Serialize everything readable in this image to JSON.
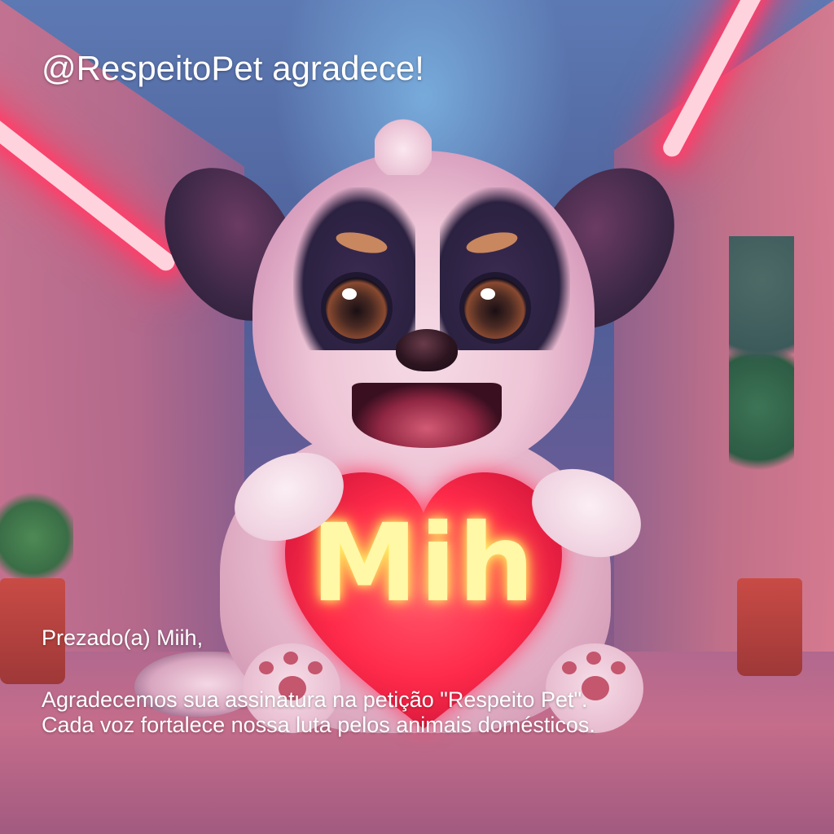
{
  "image": {
    "description_text_overlay": true
  },
  "header": {
    "title": "@RespeitoPet agradece!"
  },
  "heart": {
    "name": "Mih"
  },
  "message": {
    "greeting": "Prezado(a) Miih,",
    "line1": "Agradecemos sua assinatura na petição \"Respeito Pet\".",
    "line2": "Cada voz fortalece nossa luta pelos animais domésticos."
  },
  "colors": {
    "neon": "#ff3f6a",
    "heart": "#ff2a4a",
    "heart_text": "#fff8a6",
    "text": "#ffffff"
  }
}
